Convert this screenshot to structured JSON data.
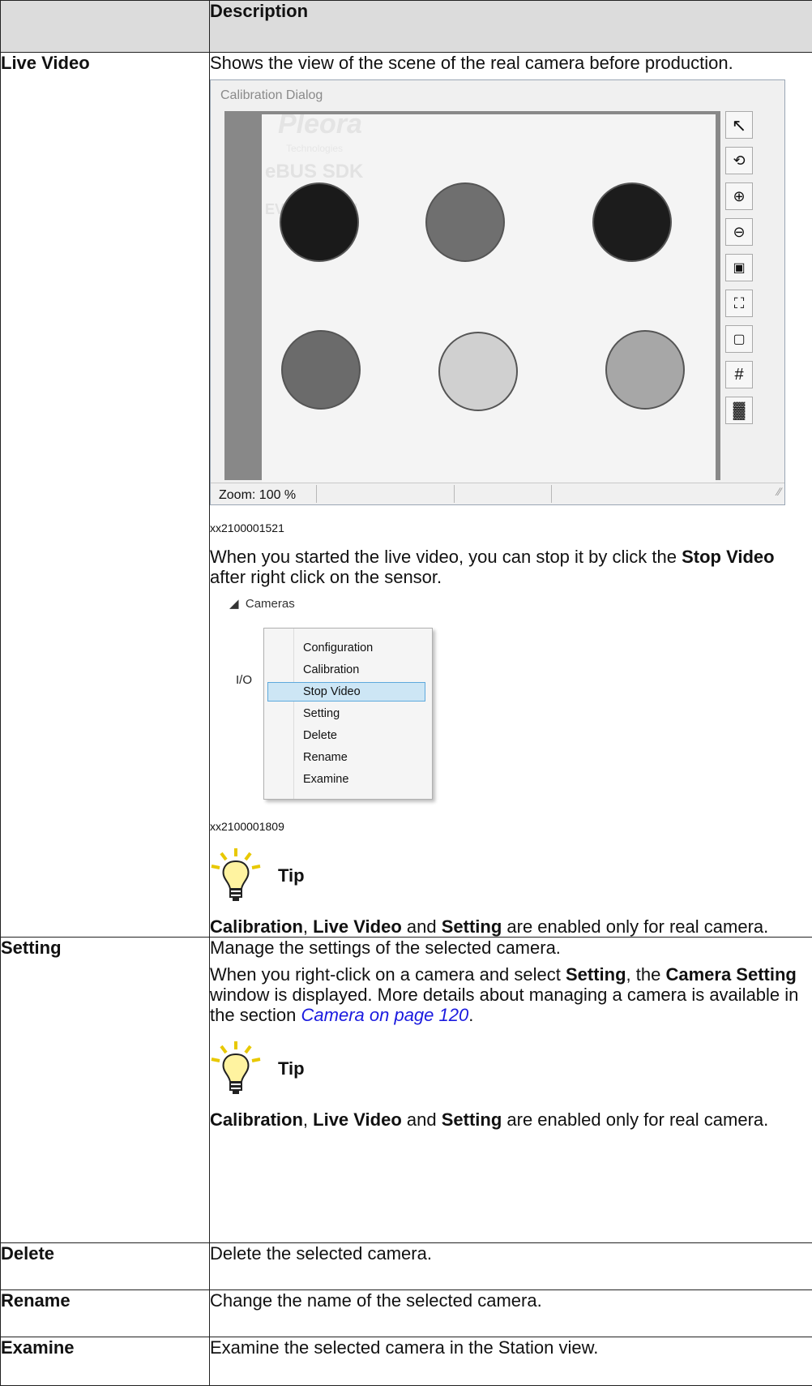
{
  "header": {
    "col1": "",
    "col2": "Description"
  },
  "rows": {
    "live_video": {
      "label": "Live Video",
      "intro": "Shows the view of the scene of the real camera before production.",
      "dialog": {
        "title": "Calibration Dialog",
        "zoom": "Zoom: 100 %"
      },
      "fig1_id": "xx2100001521",
      "stop_text_a": "When you started the live video, you can stop it by click the ",
      "stop_text_b": "Stop Video",
      "stop_text_c": " after right click on the sensor.",
      "context": {
        "tree_label": "Cameras",
        "io_label": "I/O",
        "items": [
          "Configuration",
          "Calibration",
          "Stop Video",
          "Setting",
          "Delete",
          "Rename",
          "Examine"
        ],
        "highlighted": "Stop Video"
      },
      "fig2_id": "xx2100001809",
      "tip_label": "Tip",
      "tip": {
        "a": "Calibration",
        "b": ", ",
        "c": "Live Video",
        "d": " and ",
        "e": "Setting",
        "f": " are enabled only for real camera."
      }
    },
    "setting": {
      "label": "Setting",
      "line1": "Manage the settings of the selected camera.",
      "p_a": "When you right-click on a camera and select ",
      "p_b": "Setting",
      "p_c": ", the ",
      "p_d": "Camera Setting",
      "p_e": " window is displayed. More details about managing a camera is available in the section ",
      "p_link": "Camera on page 120",
      "p_f": ".",
      "tip_label": "Tip",
      "tip": {
        "a": "Calibration",
        "b": ", ",
        "c": "Live Video",
        "d": " and ",
        "e": "Setting",
        "f": " are enabled only for real camera."
      }
    },
    "delete": {
      "label": "Delete",
      "desc": "Delete the selected camera."
    },
    "rename": {
      "label": "Rename",
      "desc": "Change the name of the selected camera."
    },
    "examine": {
      "label": "Examine",
      "desc": "Examine the selected camera in the Station view."
    }
  },
  "colors": {
    "header_bg": "#dcdcdc",
    "link": "#1a1adf",
    "tip_bulb": "#fff3a0",
    "menu_highlight": "#cde6f5"
  },
  "icons": [
    "pointer-icon",
    "rotate-select-icon",
    "zoom-in-icon",
    "zoom-out-icon",
    "image-icon",
    "fit-icon",
    "resize-icon",
    "grid-icon",
    "pattern-icon",
    "lightbulb-icon"
  ]
}
